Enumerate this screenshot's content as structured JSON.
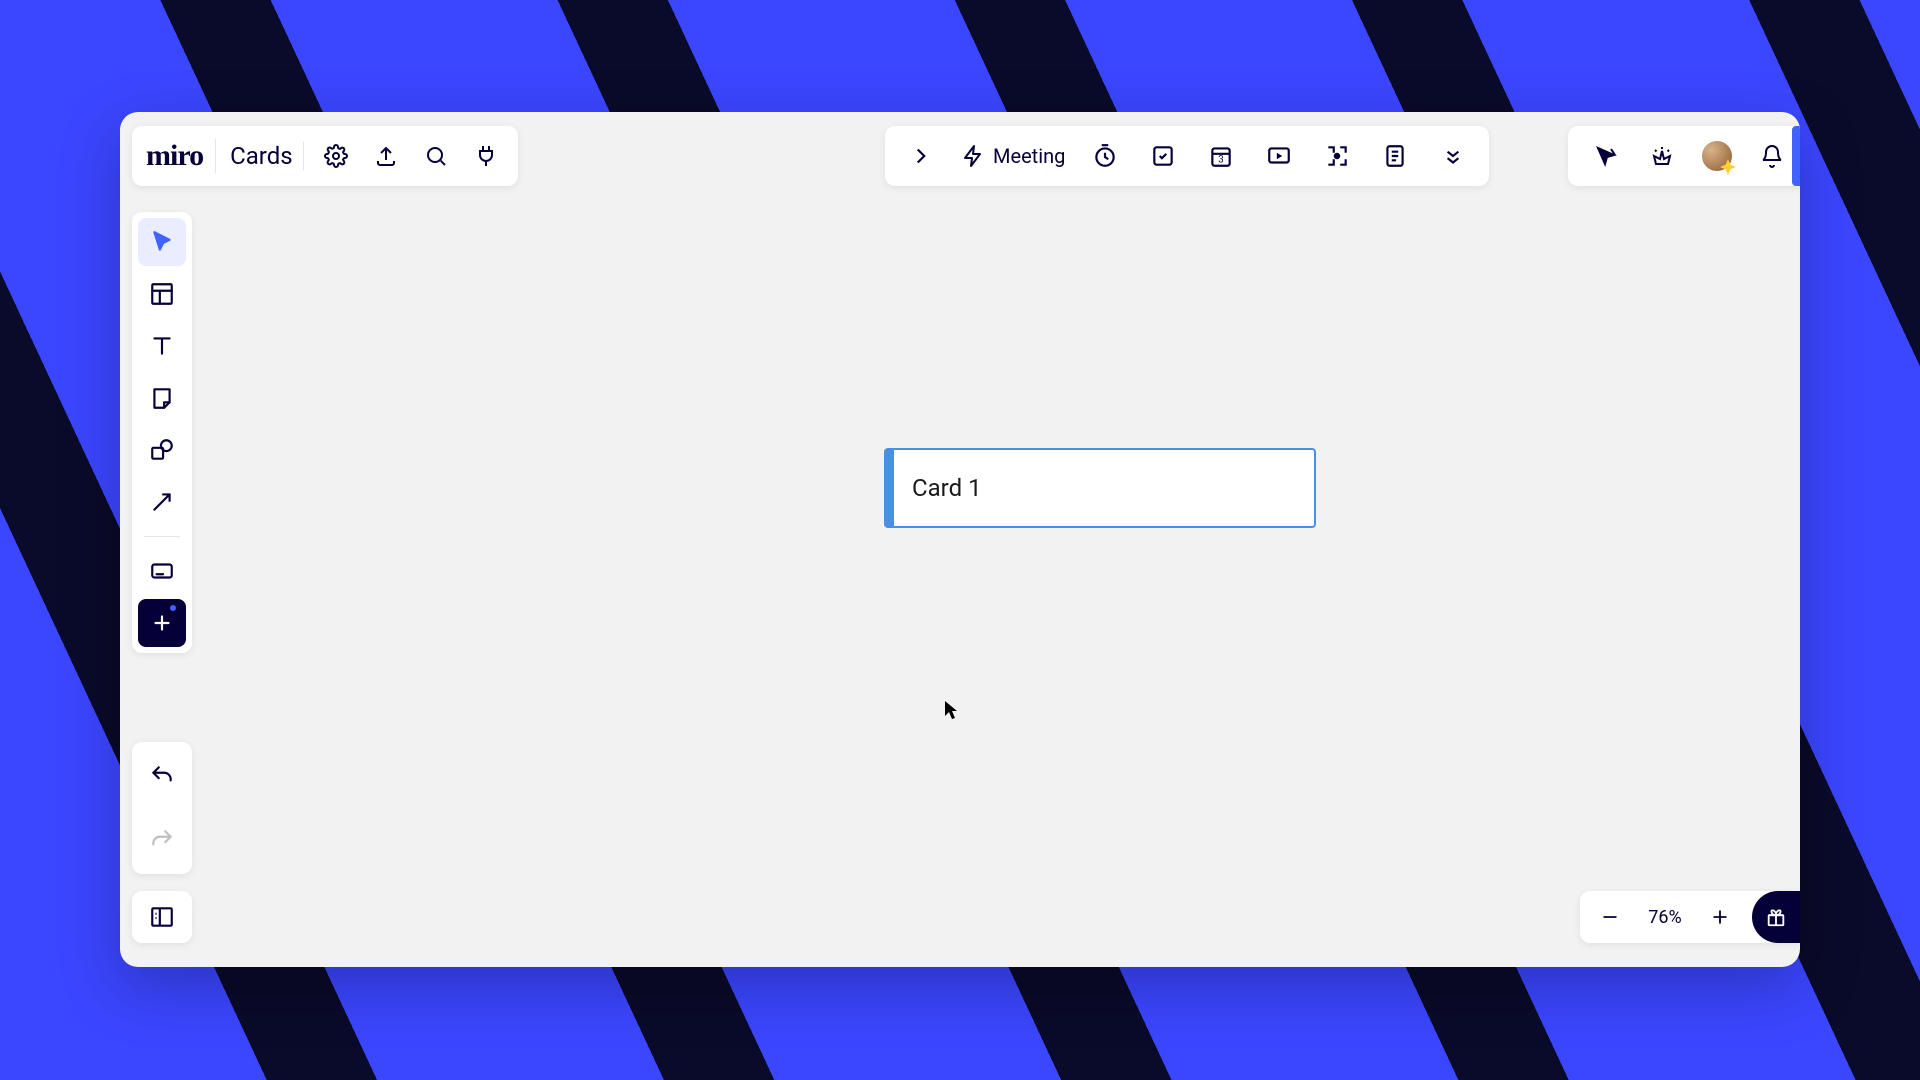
{
  "app": {
    "logo": "miro",
    "board_title": "Cards"
  },
  "topbar_center": {
    "meeting_label": "Meeting",
    "calendar_badge": "3"
  },
  "canvas": {
    "card_title": "Card 1"
  },
  "zoom": {
    "level": "76%"
  },
  "icons": {
    "settings": "settings-icon",
    "export": "export-icon",
    "search": "search-icon",
    "plugins": "plugins-icon",
    "expand_panel": "chevron-right-icon",
    "bolt": "bolt-icon",
    "timer": "timer-icon",
    "voting": "voting-icon",
    "calendar": "calendar-icon",
    "present": "present-icon",
    "attention": "attention-icon",
    "notes": "notes-icon",
    "more": "more-icon",
    "cursor_follow": "cursor-follow-icon",
    "reactions": "reactions-icon",
    "notifications": "bell-icon",
    "select": "select-tool-icon",
    "templates": "templates-icon",
    "text": "text-tool-icon",
    "sticky": "sticky-note-icon",
    "shape": "shape-tool-icon",
    "arrow": "arrow-tool-icon",
    "card": "card-tool-icon",
    "more_apps": "plus-icon",
    "undo": "undo-icon",
    "redo": "redo-icon",
    "frames": "frames-panel-icon",
    "zoom_out": "minus-icon",
    "zoom_in": "plus-icon",
    "gift": "gift-icon"
  }
}
